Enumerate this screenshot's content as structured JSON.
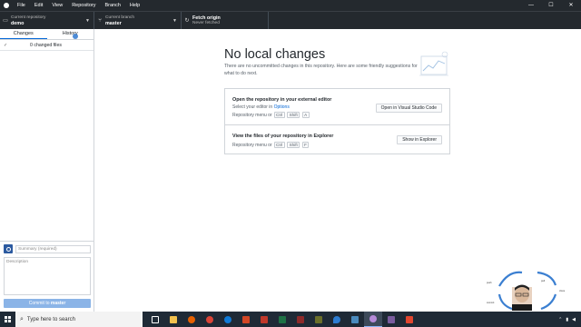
{
  "menu": [
    "File",
    "Edit",
    "View",
    "Repository",
    "Branch",
    "Help"
  ],
  "window_controls": [
    "—",
    "☐",
    "✕"
  ],
  "toolbar": {
    "repo_label": "Current repository",
    "repo_value": "demo",
    "branch_label": "Current branch",
    "branch_value": "master",
    "fetch_label": "Fetch origin",
    "fetch_value": "Never fetched"
  },
  "sidebar": {
    "tabs": [
      "Changes",
      "History"
    ],
    "changed_files": "0 changed files",
    "summary_placeholder": "Summary (required)",
    "description_placeholder": "Description",
    "commit_prefix": "Commit to",
    "commit_branch": "master"
  },
  "main": {
    "title": "No local changes",
    "subtitle": "There are no uncommitted changes in this repository. Here are some friendly suggestions for what to do next.",
    "card1": {
      "heading": "Open the repository in your external editor",
      "line1_prefix": "Select your editor in ",
      "line1_link": "Options",
      "line2_prefix": "Repository menu or",
      "keys": [
        "Ctrl",
        "Shift",
        "A"
      ],
      "button": "Open in Visual Studio Code"
    },
    "card2": {
      "heading": "View the files of your repository in Explorer",
      "line2_prefix": "Repository menu or",
      "keys": [
        "Ctrl",
        "Shift",
        "F"
      ],
      "button": "Show in Explorer"
    }
  },
  "taskbar": {
    "search_placeholder": "Type here to search"
  },
  "colors": {
    "titlebar": "#24292e",
    "accent": "#0366d6",
    "commit_button": "#8bb4e7",
    "taskbar": "#1f2a36"
  }
}
